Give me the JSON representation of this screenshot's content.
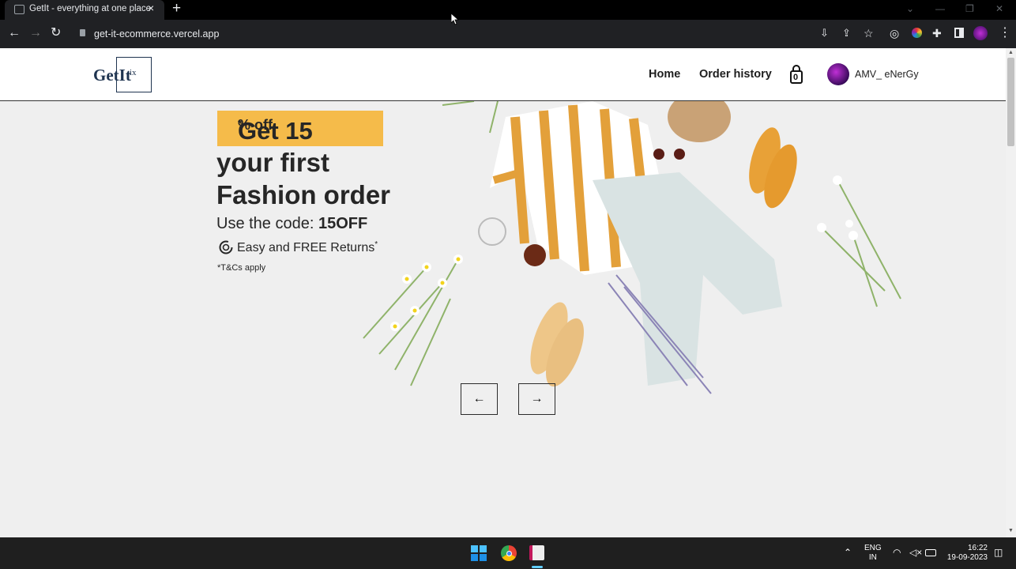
{
  "browser": {
    "tab_title": "GetIt - everything at one place",
    "tab_close": "×",
    "new_tab": "+",
    "url": "get-it-ecommerce.vercel.app"
  },
  "site": {
    "logo_text": "GetIt",
    "logo_mark": "ix",
    "nav": {
      "home": "Home",
      "orders": "Order history"
    },
    "cart_count": "0",
    "user_name": "AMV_ eNerGy"
  },
  "hero": {
    "offer_prefix": "Get 15",
    "offer_suffix": "% off",
    "offer_star": "*",
    "line2": "your first",
    "line3": "Fashion order",
    "code_label": "Use the code: ",
    "code": "15OFF",
    "returns": "Easy and FREE Returns",
    "returns_star": "*",
    "tc": "*T&Cs apply",
    "prev": "←",
    "next": "→"
  },
  "taskbar": {
    "lang_top": "ENG",
    "lang_bottom": "IN",
    "time": "16:22",
    "date": "19-09-2023"
  },
  "colors": {
    "offer_bg": "#f5bb4a",
    "brand": "#1f3450",
    "page_bg": "#efefef"
  }
}
